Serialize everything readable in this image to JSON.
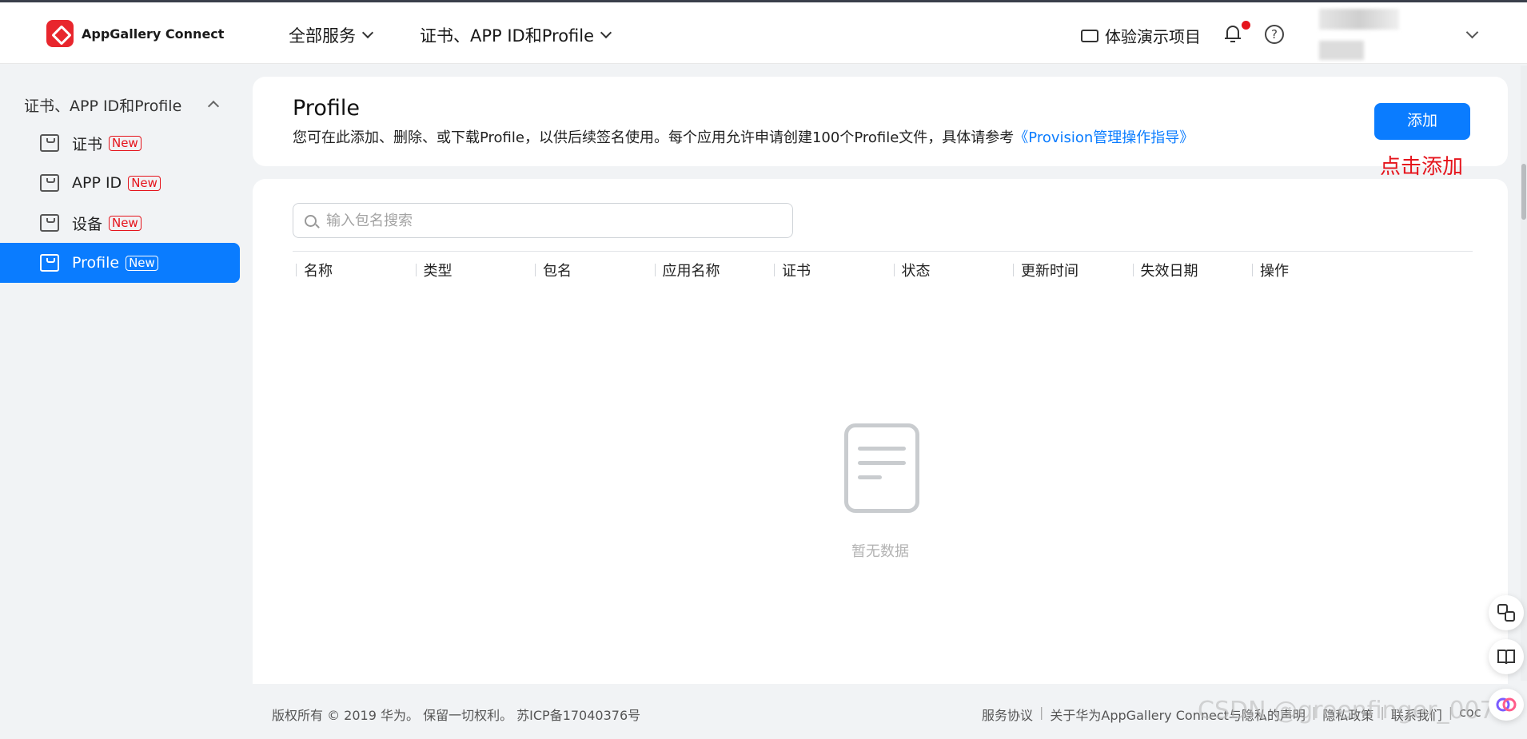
{
  "header": {
    "logo_text": "AppGallery Connect",
    "nav_all_services": "全部服务",
    "nav_certificates": "证书、APP ID和Profile",
    "demo_project": "体验演示项目",
    "help_glyph": "?"
  },
  "sidebar": {
    "section_title": "证书、APP ID和Profile",
    "items": [
      {
        "label": "证书",
        "badge": "New"
      },
      {
        "label": "APP ID",
        "badge": "New"
      },
      {
        "label": "设备",
        "badge": "New"
      },
      {
        "label": "Profile",
        "badge": "New"
      }
    ]
  },
  "page": {
    "title": "Profile",
    "description": "您可在此添加、删除、或下载Profile，以供后续签名使用。每个应用允许申请创建100个Profile文件，具体请参考",
    "guide_link": "《Provision管理操作指导》",
    "add_button": "添加",
    "annotation": "点击添加"
  },
  "search": {
    "placeholder": "输入包名搜索"
  },
  "table": {
    "columns": [
      "名称",
      "类型",
      "包名",
      "应用名称",
      "证书",
      "状态",
      "更新时间",
      "失效日期",
      "操作"
    ],
    "empty_text": "暂无数据"
  },
  "footer": {
    "copyright": "版权所有 © 2019 华为。 保留一切权利。 苏ICP备17040376号",
    "links": [
      "服务协议",
      "关于华为AppGallery Connect与隐私的声明",
      "隐私政策",
      "联系我们",
      "coc"
    ]
  },
  "watermark": "CSDN @greenfinger_007",
  "colors": {
    "accent": "#0a7cff",
    "danger": "#e5141c",
    "background": "#f1f3f5"
  },
  "icons": [
    "appgallery-logo-icon",
    "chevron-down-icon",
    "demo-project-icon",
    "bell-icon",
    "help-icon",
    "certificate-icon",
    "search-icon",
    "empty-document-icon",
    "translate-icon",
    "reader-icon",
    "assistant-icon"
  ]
}
